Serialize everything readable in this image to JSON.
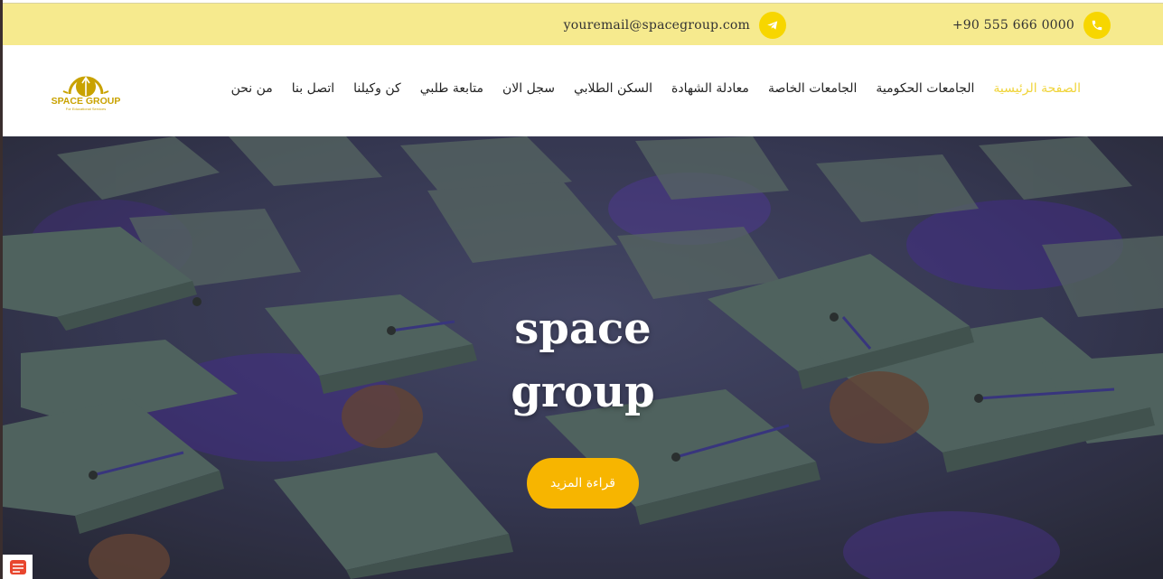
{
  "topbar": {
    "phone": "+90 555 666 0000",
    "email": "youremail@spacegroup.com",
    "phone_icon": "phone-icon",
    "email_icon": "telegram-icon",
    "bg_color": "#f6ea8e",
    "icon_color": "#f7d600"
  },
  "logo": {
    "name": "SPACE GROUP",
    "tagline": "For Educational Services",
    "color": "#c9a200"
  },
  "nav": {
    "items": [
      {
        "label": "الصفحة الرئيسية",
        "active": true
      },
      {
        "label": "الجامعات الحكومية"
      },
      {
        "label": "الجامعات الخاصة"
      },
      {
        "label": "معادلة الشهادة"
      },
      {
        "label": "السكن الطلابي"
      },
      {
        "label": "سجل الان"
      },
      {
        "label": "متابعة طلبي"
      },
      {
        "label": "كن وكيلنا"
      },
      {
        "label": "اتصل بنا"
      },
      {
        "label": "من نحن"
      }
    ],
    "active_color": "#f0d43a"
  },
  "hero": {
    "title_line1": "space",
    "title_line2": "group",
    "button_label": "قراءة المزيد",
    "button_color": "#f7b500"
  }
}
